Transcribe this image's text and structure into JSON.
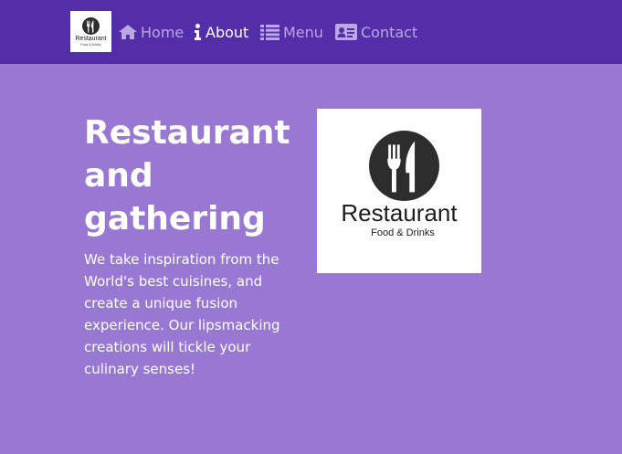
{
  "nav": {
    "logo": {
      "name": "Restaurant",
      "tagline": "Food & Drinks",
      "icon": "fork-knife-icon"
    },
    "items": [
      {
        "label": "Home",
        "icon": "home-icon",
        "active": false
      },
      {
        "label": "About",
        "icon": "info-icon",
        "active": true
      },
      {
        "label": "Menu",
        "icon": "list-icon",
        "active": false
      },
      {
        "label": "Contact",
        "icon": "address-card-icon",
        "active": false
      }
    ]
  },
  "hero": {
    "title": "Restaurant and gathering",
    "text": "We take inspiration from the World's best cuisines, and create a unique fusion experience. Our lipsmacking creations will tickle your culinary senses!",
    "image": {
      "name": "Restaurant",
      "tagline": "Food & Drinks"
    }
  },
  "colors": {
    "navbar": "#532ea8",
    "background": "#9878d2",
    "nav_text": "#b9a7e6",
    "nav_active": "#ffffff",
    "logo_dark": "#2d2d2d"
  }
}
